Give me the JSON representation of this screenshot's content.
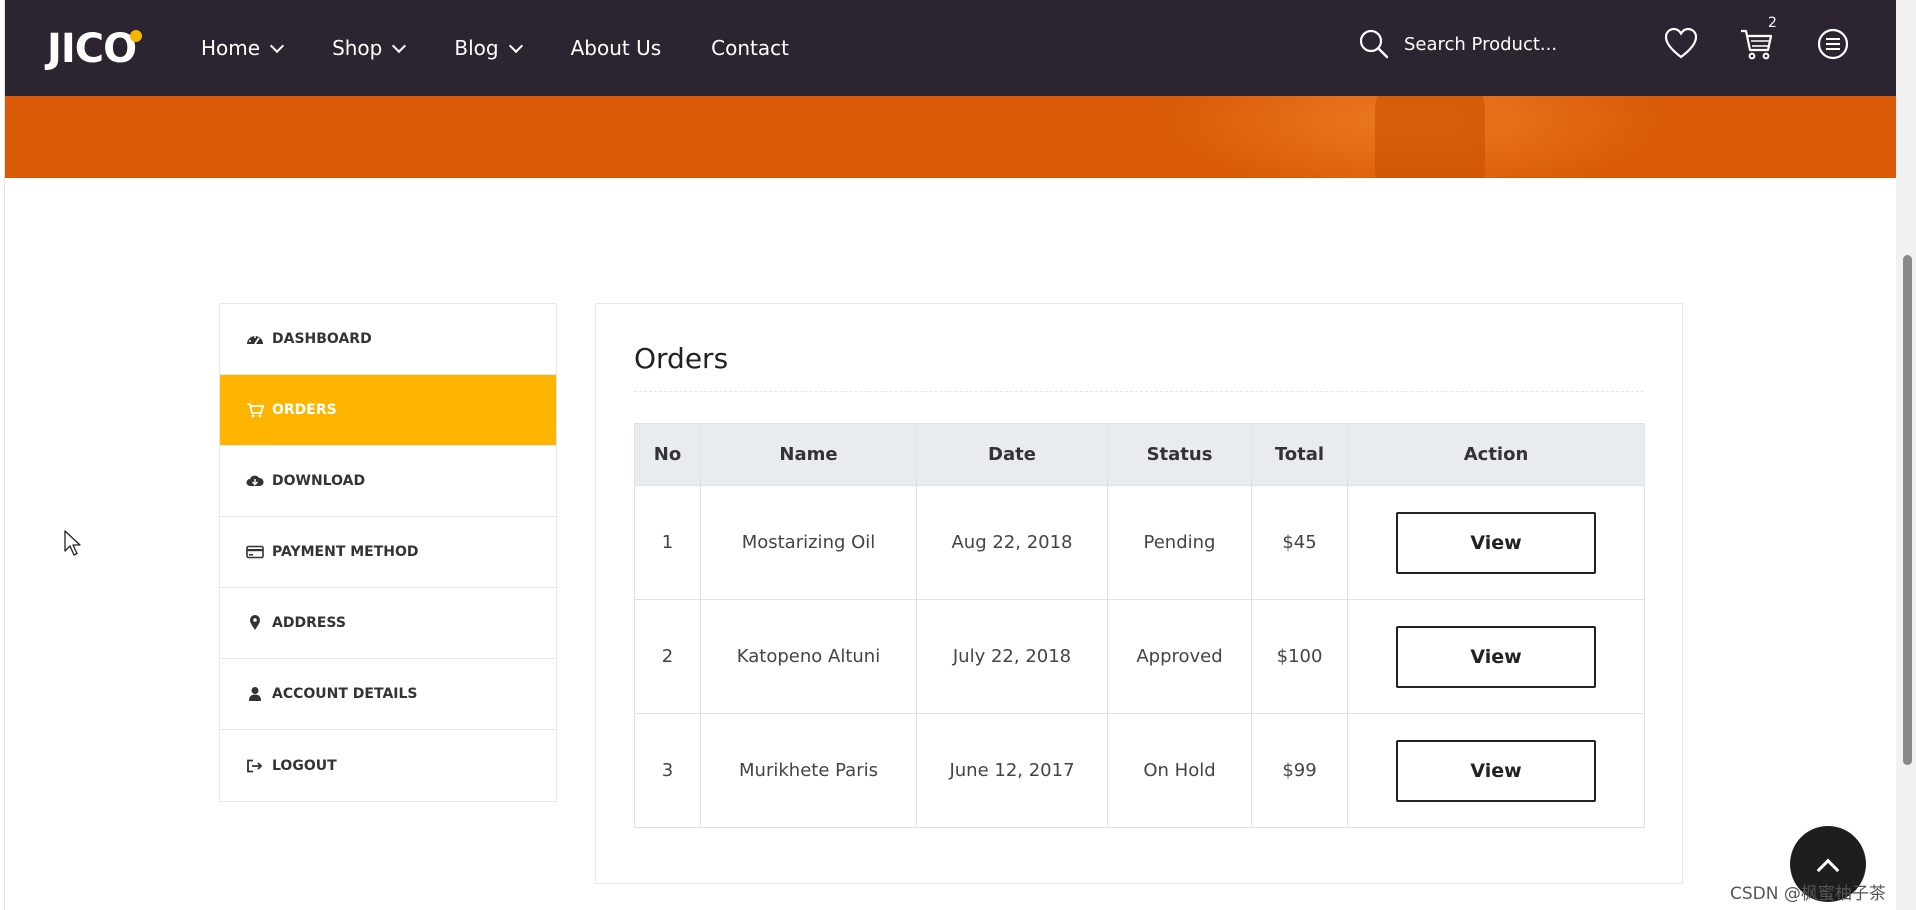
{
  "header": {
    "logo": "JICO",
    "nav": [
      {
        "label": "Home",
        "has_dropdown": true
      },
      {
        "label": "Shop",
        "has_dropdown": true
      },
      {
        "label": "Blog",
        "has_dropdown": true
      },
      {
        "label": "About Us",
        "has_dropdown": false
      },
      {
        "label": "Contact",
        "has_dropdown": false
      }
    ],
    "search_placeholder": "Search Product...",
    "cart_count": "2",
    "icons": [
      "search-icon",
      "heart-icon",
      "cart-icon",
      "menu-icon"
    ]
  },
  "sidebar": {
    "items": [
      {
        "label": "DASHBOARD",
        "icon": "dashboard-icon",
        "active": false
      },
      {
        "label": "ORDERS",
        "icon": "cart-icon",
        "active": true
      },
      {
        "label": "DOWNLOAD",
        "icon": "cloud-download-icon",
        "active": false
      },
      {
        "label": "PAYMENT METHOD",
        "icon": "credit-card-icon",
        "active": false
      },
      {
        "label": "ADDRESS",
        "icon": "map-marker-icon",
        "active": false
      },
      {
        "label": "ACCOUNT DETAILS",
        "icon": "user-icon",
        "active": false
      },
      {
        "label": "LOGOUT",
        "icon": "sign-out-icon",
        "active": false
      }
    ]
  },
  "orders": {
    "title": "Orders",
    "columns": [
      "No",
      "Name",
      "Date",
      "Status",
      "Total",
      "Action"
    ],
    "rows": [
      {
        "no": "1",
        "name": "Mostarizing Oil",
        "date": "Aug 22, 2018",
        "status": "Pending",
        "total": "$45",
        "action": "View"
      },
      {
        "no": "2",
        "name": "Katopeno Altuni",
        "date": "July 22, 2018",
        "status": "Approved",
        "total": "$100",
        "action": "View"
      },
      {
        "no": "3",
        "name": "Murikhete Paris",
        "date": "June 12, 2017",
        "status": "On Hold",
        "total": "$99",
        "action": "View"
      }
    ]
  },
  "watermark": "CSDN @枫蜜柚子茶",
  "colors": {
    "header_bg": "#2c2430",
    "hero_bg": "#d85a06",
    "accent": "#ffb500",
    "logo_dot": "#f7b500"
  }
}
